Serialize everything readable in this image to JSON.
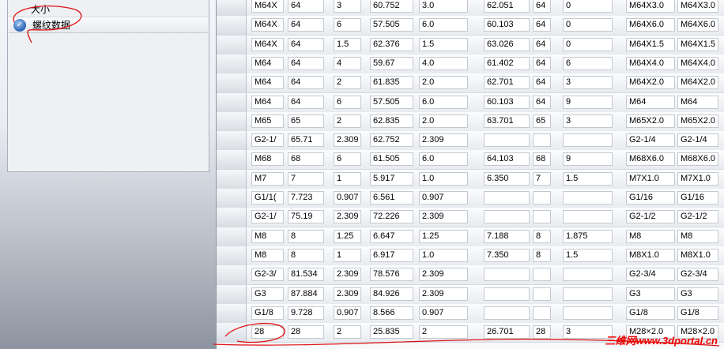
{
  "tree": {
    "items": [
      {
        "label": "大小"
      },
      {
        "label": "螺纹数据"
      }
    ]
  },
  "table": {
    "rows": [
      [
        "M64X",
        "64",
        "3",
        "60.752",
        "3.0",
        "62.051",
        "64",
        "0",
        "M64X3.0",
        "M64X3.0"
      ],
      [
        "M64X",
        "64",
        "6",
        "57.505",
        "6.0",
        "60.103",
        "64",
        "0",
        "M64X6.0",
        "M64X6.0"
      ],
      [
        "M64X",
        "64",
        "1.5",
        "62.376",
        "1.5",
        "63.026",
        "64",
        "0",
        "M64X1.5",
        "M64X1.5"
      ],
      [
        "M64",
        "64",
        "4",
        "59.67",
        "4.0",
        "61.402",
        "64",
        "6",
        "M64X4.0",
        "M64X4.0"
      ],
      [
        "M64",
        "64",
        "2",
        "61.835",
        "2.0",
        "62.701",
        "64",
        "3",
        "M64X2.0",
        "M64X2.0"
      ],
      [
        "M64",
        "64",
        "6",
        "57.505",
        "6.0",
        "60.103",
        "64",
        "9",
        "M64",
        "M64"
      ],
      [
        "M65",
        "65",
        "2",
        "62.835",
        "2.0",
        "63.701",
        "65",
        "3",
        "M65X2.0",
        "M65X2.0"
      ],
      [
        "G2-1/",
        "65.71",
        "2.309",
        "62.752",
        "2.309",
        "",
        "",
        "",
        "G2-1/4",
        "G2-1/4"
      ],
      [
        "M68",
        "68",
        "6",
        "61.505",
        "6.0",
        "64.103",
        "68",
        "9",
        "M68X6.0",
        "M68X6.0"
      ],
      [
        "M7",
        "7",
        "1",
        "5.917",
        "1.0",
        "6.350",
        "7",
        "1.5",
        "M7X1.0",
        "M7X1.0"
      ],
      [
        "G1/1(",
        "7.723",
        "0.907",
        "6.561",
        "0.907",
        "",
        "",
        "",
        "G1/16",
        "G1/16"
      ],
      [
        "G2-1/",
        "75.19",
        "2.309",
        "72.226",
        "2.309",
        "",
        "",
        "",
        "G2-1/2",
        "G2-1/2"
      ],
      [
        "M8",
        "8",
        "1.25",
        "6.647",
        "1.25",
        "7.188",
        "8",
        "1.875",
        "M8",
        "M8"
      ],
      [
        "M8",
        "8",
        "1",
        "6.917",
        "1.0",
        "7.350",
        "8",
        "1.5",
        "M8X1.0",
        "M8X1.0"
      ],
      [
        "G2-3/",
        "81.534",
        "2.309",
        "78.576",
        "2.309",
        "",
        "",
        "",
        "G2-3/4",
        "G2-3/4"
      ],
      [
        "G3",
        "87.884",
        "2.309",
        "84.926",
        "2.309",
        "",
        "",
        "",
        "G3",
        "G3"
      ],
      [
        "G1/8",
        "9.728",
        "0.907",
        "8.566",
        "0.907",
        "",
        "",
        "",
        "G1/8",
        "G1/8"
      ],
      [
        "28",
        "28",
        "2",
        "25.835",
        "2",
        "26.701",
        "28",
        "3",
        "M28×2.0",
        "M28×2.0"
      ]
    ]
  },
  "watermark": "三维网www.3dportal.cn",
  "colors": {
    "annotation": "#dd1111"
  }
}
